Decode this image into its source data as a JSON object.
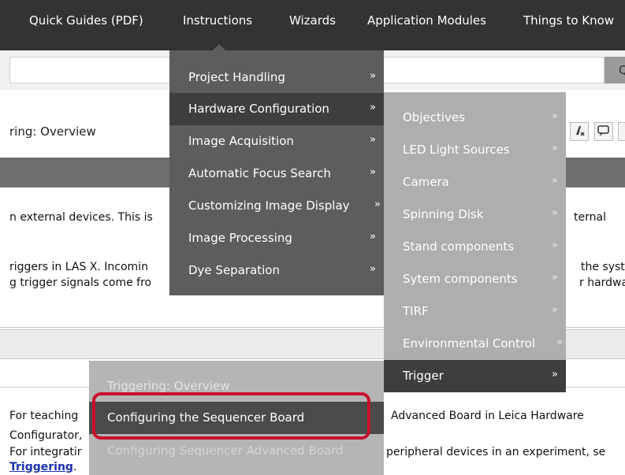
{
  "nav": {
    "items": [
      "Quick Guides (PDF)",
      "Instructions",
      "Wizards",
      "Application Modules",
      "Things to Know"
    ]
  },
  "search": {
    "button_glyph": "Q"
  },
  "header": {
    "title_partial": "ring: Overview",
    "icons": [
      "clear-format-icon",
      "comment-icon"
    ]
  },
  "body": {
    "line1_left": "n external devices. This is",
    "line1_right": "ternal",
    "line2_left": "riggers in LAS X. Incomin",
    "line2_right": "the syster",
    "line3_left": "g trigger signals come fro",
    "line3_right": "r hardwar",
    "p1_left": "For teaching",
    "p1_right": "Advanced Board in Leica Hardware",
    "p1b_left": "Configurator,",
    "p2_left": "For integratir",
    "p2_right": "peripheral devices in an experiment, se",
    "link_text": "Triggering",
    "link_after": "."
  },
  "menu1": {
    "items": [
      {
        "label": "Project Handling",
        "arrow": "»"
      },
      {
        "label": "Hardware Configuration",
        "arrow": "»"
      },
      {
        "label": "Image Acquisition",
        "arrow": "»"
      },
      {
        "label": "Automatic Focus Search",
        "arrow": "»"
      },
      {
        "label": "Customizing Image Display",
        "arrow": "»"
      },
      {
        "label": "Image Processing",
        "arrow": "»"
      },
      {
        "label": "Dye Separation",
        "arrow": "»"
      }
    ]
  },
  "menu2": {
    "items": [
      {
        "label": "Objectives",
        "arrow": "»"
      },
      {
        "label": "LED Light Sources",
        "arrow": "»"
      },
      {
        "label": "Camera",
        "arrow": "»"
      },
      {
        "label": "Spinning Disk",
        "arrow": "»"
      },
      {
        "label": "Stand components",
        "arrow": "»"
      },
      {
        "label": "Sytem components",
        "arrow": "»"
      },
      {
        "label": "TIRF",
        "arrow": "»"
      },
      {
        "label": "Environmental Control",
        "arrow": "»"
      },
      {
        "label": "Trigger",
        "arrow": "»"
      }
    ]
  },
  "menu3": {
    "items": [
      {
        "label": "Triggering: Overview"
      },
      {
        "label": "Configuring the Sequencer Board"
      },
      {
        "label": "Configuring Sequencer Advanced Board"
      }
    ]
  },
  "colors": {
    "nav_bg": "#333333",
    "menu_dark": "#5d5d5d",
    "menu_light": "#aeaeae",
    "highlight_ring": "#c8102e",
    "link": "#1a2fb0"
  }
}
